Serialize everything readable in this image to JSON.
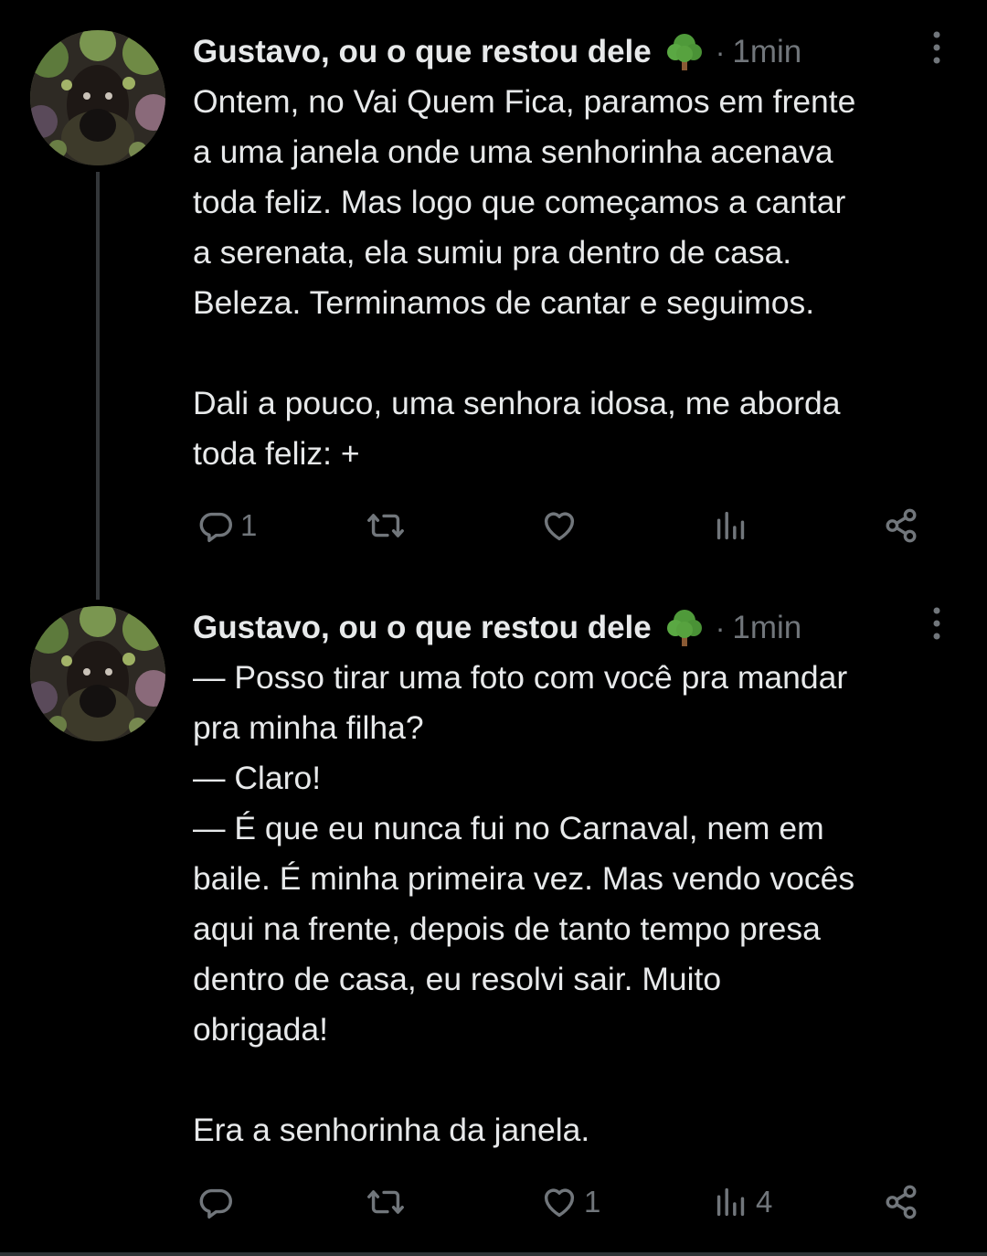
{
  "tweets": [
    {
      "author": "Gustavo, ou o que restou dele",
      "emoji": "tree-emoji",
      "separator": "·",
      "time": "1min",
      "text": "Ontem, no Vai Quem Fica, paramos em frente\na uma janela onde uma senhorinha acenava\ntoda feliz. Mas logo que começamos a cantar\na serenata, ela sumiu pra dentro de casa.\nBeleza. Terminamos de cantar e seguimos.\n\nDali a pouco, uma senhora idosa, me aborda\ntoda feliz: +",
      "stats": {
        "replies": "1",
        "retweets": "",
        "likes": "",
        "views": ""
      }
    },
    {
      "author": "Gustavo, ou o que restou dele",
      "emoji": "tree-emoji",
      "separator": "·",
      "time": "1min",
      "text": "— Posso tirar uma foto com você pra mandar\npra minha filha?\n— Claro!\n— É que eu nunca fui no Carnaval, nem em\nbaile. É minha primeira vez. Mas vendo vocês\naqui na frente, depois de tanto tempo presa\ndentro de casa, eu resolvi sair. Muito\nobrigada!\n\nEra a senhorinha da janela.",
      "stats": {
        "replies": "",
        "retweets": "",
        "likes": "1",
        "views": "4"
      }
    }
  ],
  "icons": {
    "reply": "reply-icon",
    "retweet": "retweet-icon",
    "like": "heart-icon",
    "views": "views-icon",
    "share": "share-icon",
    "more": "more-vertical-icon"
  },
  "colors": {
    "background": "#000000",
    "text": "#e7e9ea",
    "secondary": "#71767b",
    "thread_line": "#333639"
  }
}
